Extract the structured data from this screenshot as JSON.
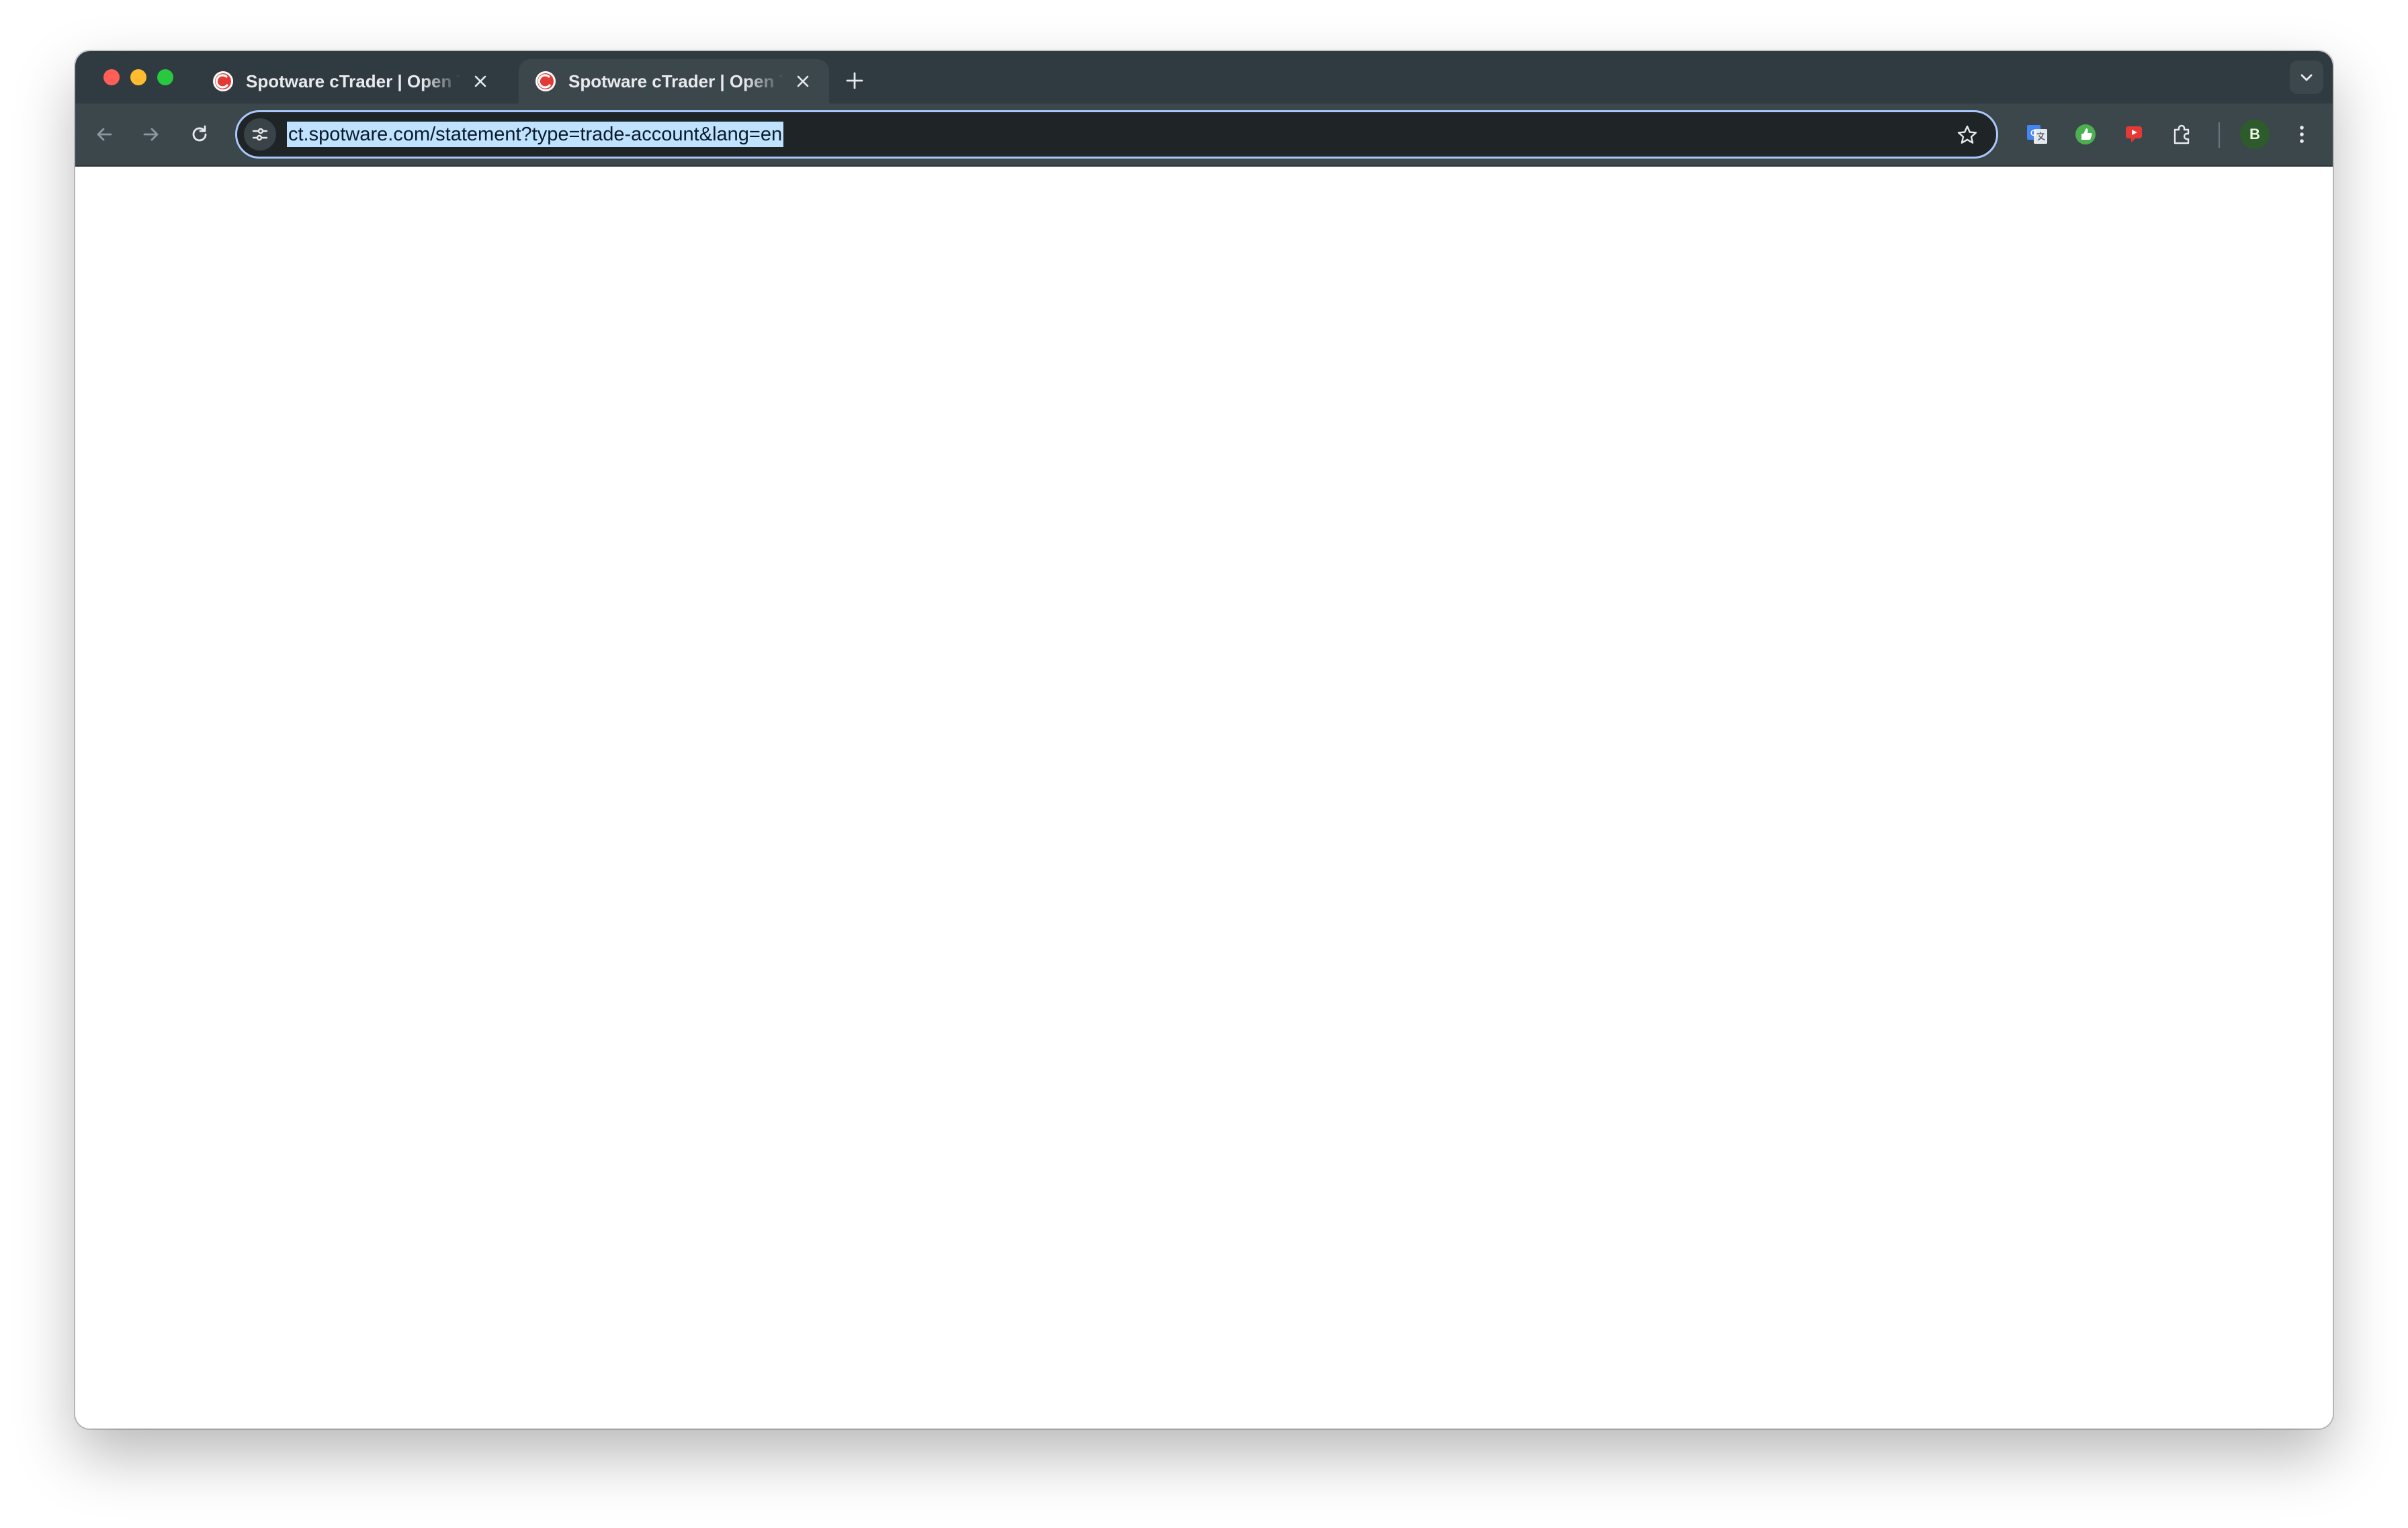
{
  "window": {
    "controls": {
      "close": "close-window",
      "minimize": "minimize-window",
      "maximize": "maximize-window"
    }
  },
  "tabs": [
    {
      "title": "Spotware cTrader | Open Trading Platform",
      "active": false,
      "favicon": "ctrader-icon"
    },
    {
      "title": "Spotware cTrader | Open Trading Platform",
      "active": true,
      "favicon": "ctrader-icon"
    }
  ],
  "toolbar": {
    "url": "ct.spotware.com/statement?type=trade-account&lang=en",
    "url_selected": true,
    "icons": {
      "back": "arrow-left-icon",
      "forward": "arrow-right-icon",
      "reload": "reload-icon",
      "site_info": "tune-icon",
      "bookmark": "star-icon",
      "extensions": "puzzle-icon",
      "menu": "kebab-menu-icon"
    }
  },
  "extensions": [
    {
      "name": "google-translate-icon"
    },
    {
      "name": "green-thumbs-up-icon"
    },
    {
      "name": "red-cast-icon"
    }
  ],
  "profile": {
    "initial": "B",
    "color": "#2e5b2b"
  },
  "colors": {
    "tabstrip": "#2f3b40",
    "toolbar": "#3c474c",
    "omnibox": "#1f2426",
    "focus_ring": "#a8c7fa",
    "url_highlight": "#bfe3ff",
    "brand_red": "#e53935"
  },
  "content": {
    "state": "blank"
  }
}
